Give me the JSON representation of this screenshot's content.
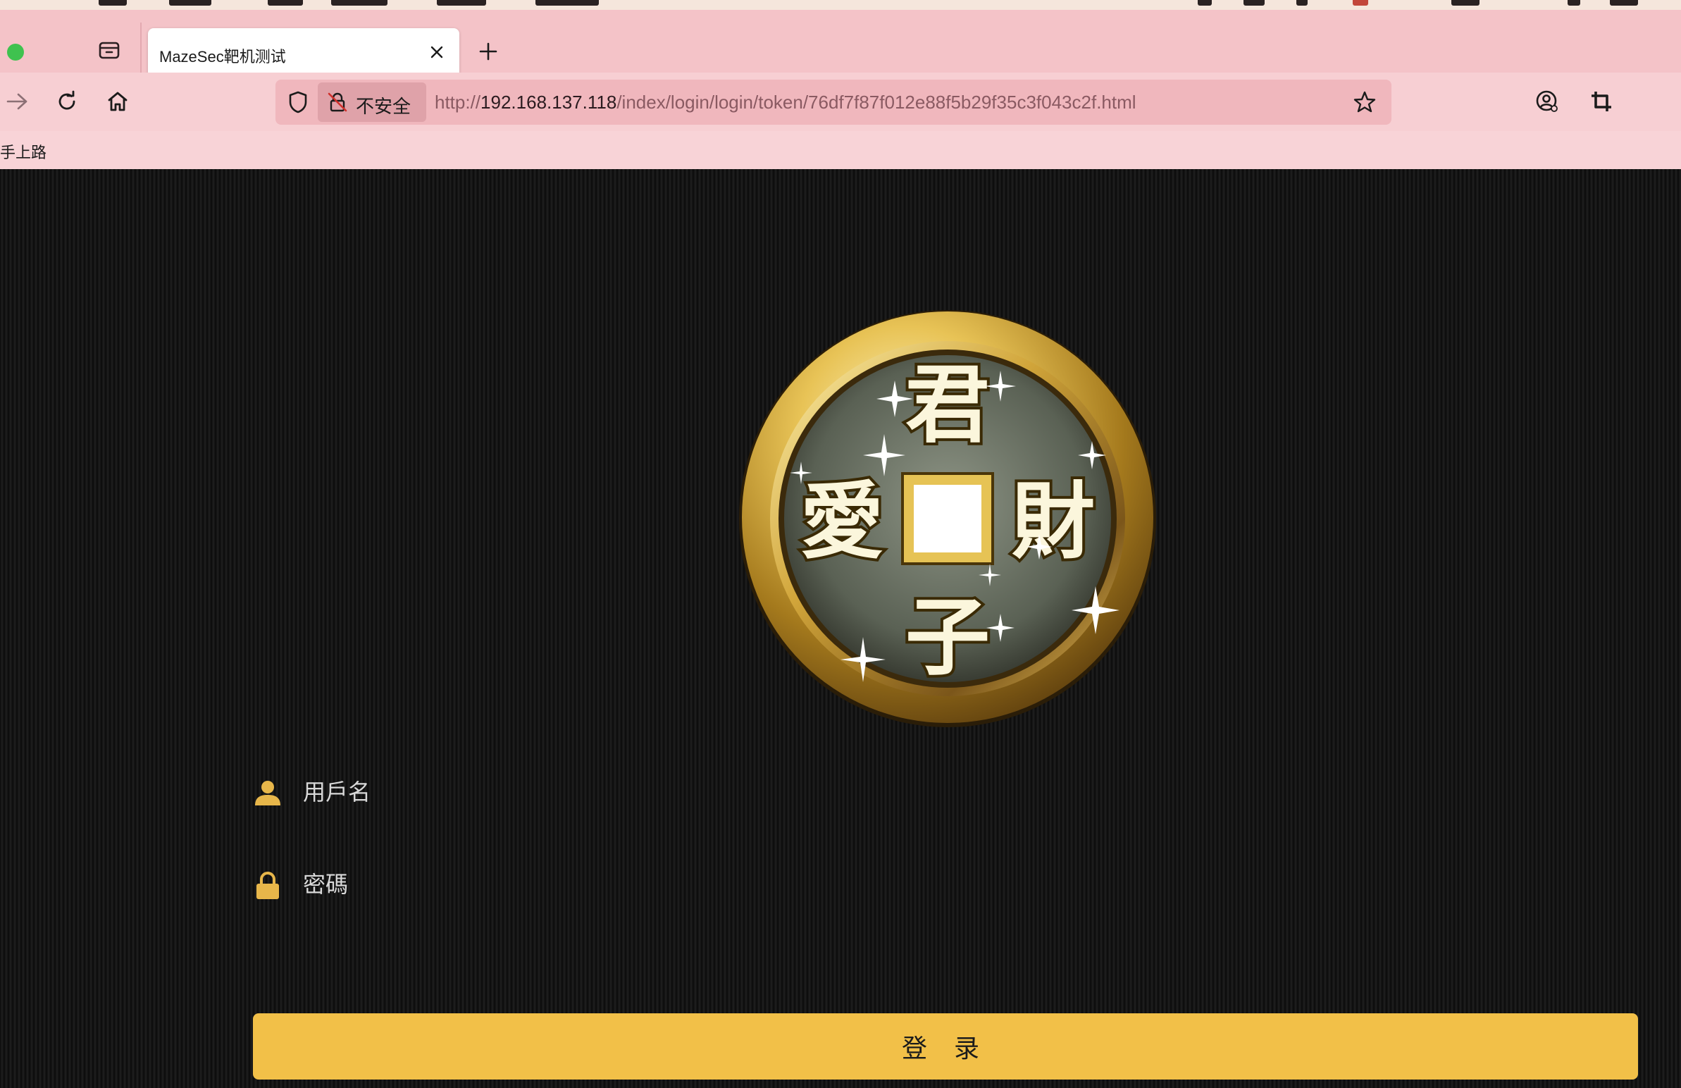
{
  "browser": {
    "tab": {
      "title": "MazeSec靶机测试"
    },
    "urlbar": {
      "security_label": "不安全",
      "url_scheme": "http://",
      "url_host": "192.168.137.118",
      "url_path": "/index/login/login/token/76df7f87f012e88f5b29f35c3f043c2f.html"
    },
    "bookmarks": [
      "手上路"
    ]
  },
  "page": {
    "logo": {
      "chars": {
        "top": "君",
        "left": "愛",
        "right": "財",
        "bottom": "子"
      }
    },
    "username": {
      "placeholder": "用戶名",
      "value": ""
    },
    "password": {
      "placeholder": "密碼",
      "value": ""
    },
    "login_button": "登 录"
  },
  "colors": {
    "accent": "#f2c048",
    "tabbar": "#f4c3c8",
    "navbar": "#f7cfd3",
    "page_bg": "#141414"
  }
}
